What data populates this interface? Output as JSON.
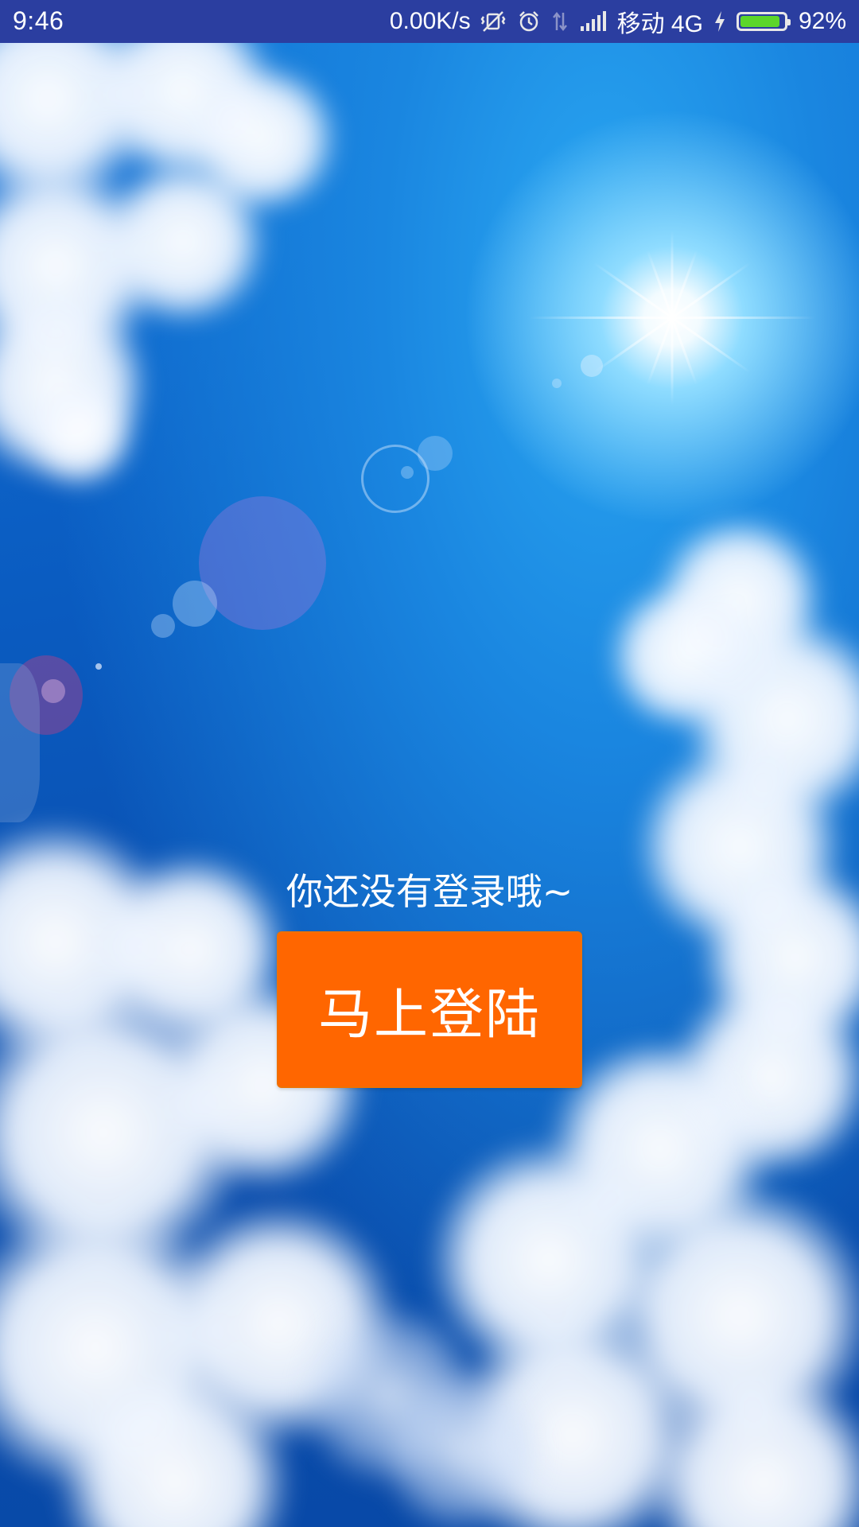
{
  "status_bar": {
    "time": "9:46",
    "network_speed": "0.00K/s",
    "carrier": "移动 4G",
    "battery_percent": "92%",
    "battery_level": 0.92,
    "icons": [
      "vibrate-off-icon",
      "alarm-icon",
      "data-transfer-icon",
      "signal-icon",
      "charging-icon",
      "battery-icon"
    ],
    "battery_color": "#5cd62a"
  },
  "main": {
    "prompt": "你还没有登录哦~",
    "login_button_label": "马上登陆"
  },
  "colors": {
    "status_bar_bg": "#2b3ea0",
    "login_button_bg": "#ff6600",
    "text": "#ffffff"
  }
}
